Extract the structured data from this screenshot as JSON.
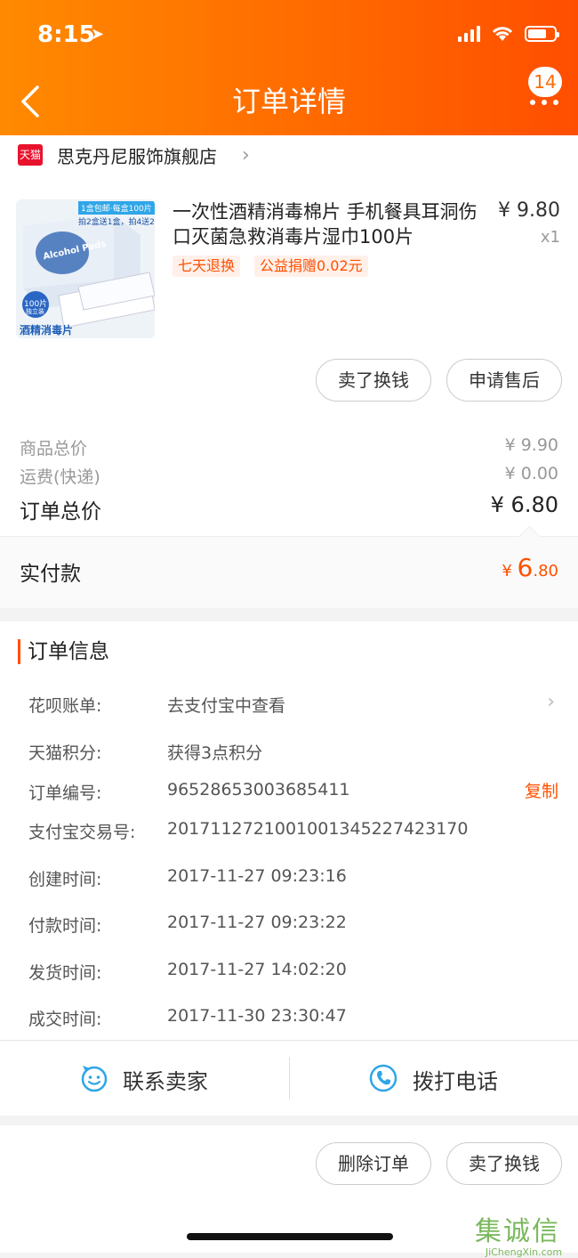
{
  "status_bar": {
    "time": "8:15"
  },
  "nav": {
    "title": "订单详情",
    "badge_count": "14"
  },
  "shop": {
    "platform_logo": "天猫",
    "name": "思克丹尼服饰旗舰店"
  },
  "product": {
    "image_texts": {
      "promo_a": "1盒包邮·每盒100片",
      "promo_b": "拍2盒送1盒，拍4送2",
      "brand": "Alcohol Pads",
      "count": "100片",
      "count_sub": "独立装",
      "caption": "酒精消毒片"
    },
    "title": "一次性酒精消毒棉片 手机餐具耳洞伤口灭菌急救消毒片湿巾100片",
    "price": "¥ 9.80",
    "qty": "x1",
    "tags": [
      "七天退换",
      "公益捐赠0.02元"
    ],
    "actions": [
      "卖了换钱",
      "申请售后"
    ]
  },
  "summary": {
    "goods_label": "商品总价",
    "goods_value": "¥ 9.90",
    "shipping_label": "运费(快递)",
    "shipping_value": "¥ 0.00",
    "total_label": "订单总价",
    "total_value": "¥ 6.80",
    "paid_label": "实付款",
    "paid_currency": "¥",
    "paid_int": "6",
    "paid_dec": ".80"
  },
  "order_info": {
    "heading": "订单信息",
    "rows": [
      {
        "label": "花呗账单:",
        "value": "去支付宝中查看"
      },
      {
        "label": "天猫积分:",
        "value": "获得3点积分"
      },
      {
        "label": "订单编号:",
        "value": "96528653003685411"
      },
      {
        "label": "支付宝交易号:",
        "value": "2017112721001001345227423170"
      },
      {
        "label": "创建时间:",
        "value": "2017-11-27 09:23:16"
      },
      {
        "label": "付款时间:",
        "value": "2017-11-27 09:23:22"
      },
      {
        "label": "发货时间:",
        "value": "2017-11-27 14:02:20"
      },
      {
        "label": "成交时间:",
        "value": "2017-11-30 23:30:47"
      }
    ],
    "copy_label": "复制"
  },
  "contact": {
    "seller_label": "联系卖家",
    "phone_label": "拨打电话"
  },
  "bottom_actions": [
    "删除订单",
    "卖了换钱"
  ],
  "watermark": {
    "cn": "集诚信",
    "en": "JiChengXin.com"
  },
  "colors": {
    "header_start": "#ff8a00",
    "header_end": "#ff4e00",
    "accent": "#ff5000",
    "icon_blue": "#2fa6e8"
  }
}
